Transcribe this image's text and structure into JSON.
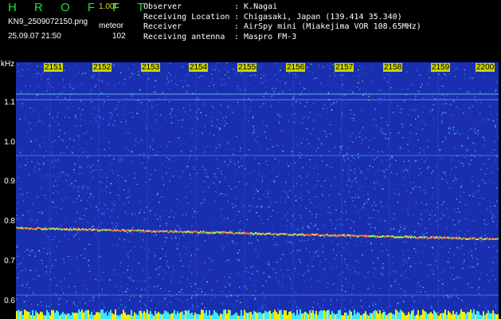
{
  "header": {
    "logo": "H R O F F T",
    "version": "1.00f",
    "filename": "KN9_2509072150.png",
    "mode": "meteor",
    "datetime": "25.09.07 21:50",
    "count": "102"
  },
  "info": [
    {
      "key": "Observer",
      "value": ": K.Nagai"
    },
    {
      "key": "Receiving Location",
      "value": ": Chigasaki, Japan (139.414 35.340)"
    },
    {
      "key": "Receiver",
      "value": ": AirSpy mini (Miakejima VOR 108.65MHz)"
    },
    {
      "key": "Receiving antenna",
      "value": ": Maspro FM-3"
    }
  ],
  "axis": {
    "unit": "kHz",
    "y_ticks": [
      "1.1",
      "1.0",
      "0.9",
      "0.8",
      "0.7",
      "0.6"
    ],
    "time_ticks": [
      "2151",
      "2152",
      "2153",
      "2154",
      "2155",
      "2156",
      "2157",
      "2158",
      "2159",
      "2200"
    ]
  },
  "colors": {
    "background": "#1a2fb0",
    "noise": "#2f6bff",
    "signal": "#ff6a2a",
    "label_bg": "#c8d400"
  }
}
